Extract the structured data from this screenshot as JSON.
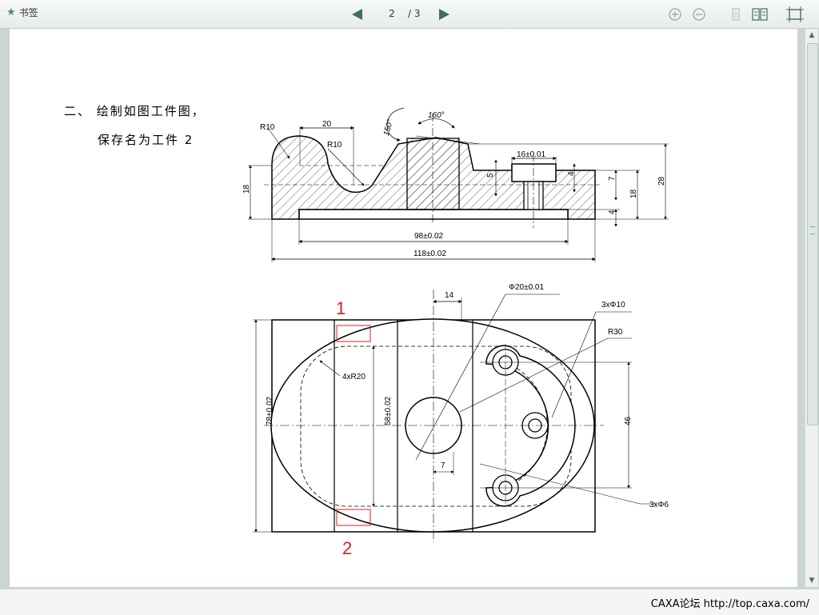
{
  "toolbar": {
    "bookmark_label": "书签",
    "current_page": "2",
    "total_pages": "/ 3"
  },
  "document": {
    "question_line1": "二、 绘制如图工件图，",
    "question_line2": "保存名为工件 2"
  },
  "front_view": {
    "dims": {
      "r10_left": "R10",
      "width_20": "20",
      "r10_right": "R10",
      "angle_150": "150°",
      "angle_160": "160°",
      "dim_16": "16±0.01",
      "dim_5": "5",
      "dim_4_top": "4",
      "dim_7": "7",
      "dim_18_right": "18",
      "dim_28": "28",
      "dim_4_bottom": "4",
      "dim_18_left": "18",
      "dim_98": "98±0.02",
      "dim_118": "118±0.02"
    }
  },
  "top_view": {
    "dims": {
      "dim_14": "14",
      "dim_phi20": "Φ20±0.01",
      "dim_3phi10": "3xΦ10",
      "dim_r30": "R30",
      "dim_4r20": "4xR20",
      "dim_78": "78±0.02",
      "dim_58": "58±0.02",
      "dim_46": "46",
      "dim_7": "7",
      "dim_3phi6": "3xΦ6"
    },
    "callouts": {
      "label_1": "1",
      "label_2": "2"
    }
  },
  "status": {
    "watermark": "CAXA论坛 http://top.caxa.com/"
  },
  "colors": {
    "callout_red": "#d42020",
    "icon_green": "#3f6f63",
    "page_bg": "#c9d6d3"
  }
}
